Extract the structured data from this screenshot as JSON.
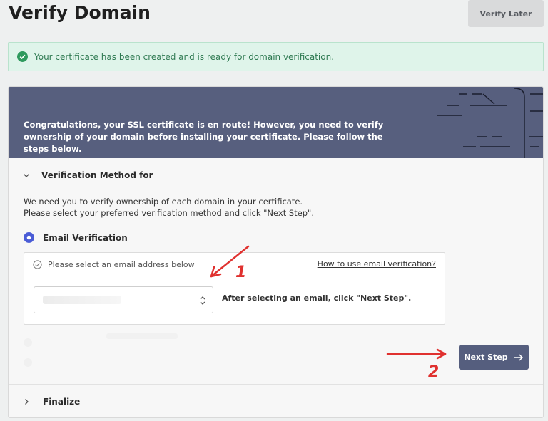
{
  "page": {
    "title": "Verify Domain"
  },
  "header": {
    "verify_later_label": "Verify Later"
  },
  "alert": {
    "text": "Your certificate has been created and is ready for domain verification.",
    "color": "#2f7a52"
  },
  "banner": {
    "text": "Congratulations, your SSL certificate is en route! However, you need to verify ownership of your domain before installing your certificate. Please follow the steps below.",
    "color": "#575f7e"
  },
  "verification": {
    "section_title": "Verification Method for",
    "intro_line1": "We need you to verify ownership of each domain in your certificate.",
    "intro_line2": "Please select your preferred verification method and click \"Next Step\".",
    "email_option_label": "Email Verification",
    "email_box": {
      "header_text": "Please select an email address below",
      "help_link": "How to use email verification?",
      "select_value": "",
      "after_text": "After selecting an email, click \"Next Step\"."
    },
    "next_step_label": "Next Step"
  },
  "finalize": {
    "section_title": "Finalize"
  },
  "annotations": {
    "marker_1": "1",
    "marker_2": "2",
    "color": "#e0312f"
  }
}
